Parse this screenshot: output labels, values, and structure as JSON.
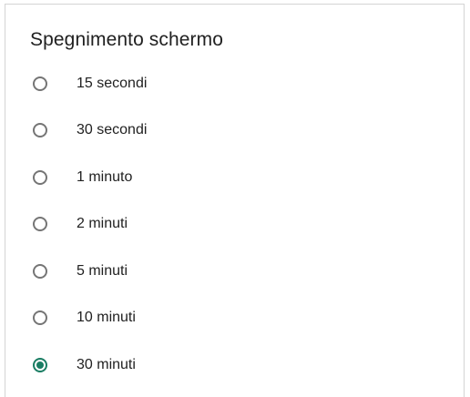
{
  "dialog": {
    "title": "Spegnimento schermo",
    "accent_color": "#1a7d63",
    "options": [
      {
        "label": "15 secondi",
        "selected": false
      },
      {
        "label": "30 secondi",
        "selected": false
      },
      {
        "label": "1 minuto",
        "selected": false
      },
      {
        "label": "2 minuti",
        "selected": false
      },
      {
        "label": "5 minuti",
        "selected": false
      },
      {
        "label": "10 minuti",
        "selected": false
      },
      {
        "label": "30 minuti",
        "selected": true
      }
    ]
  }
}
